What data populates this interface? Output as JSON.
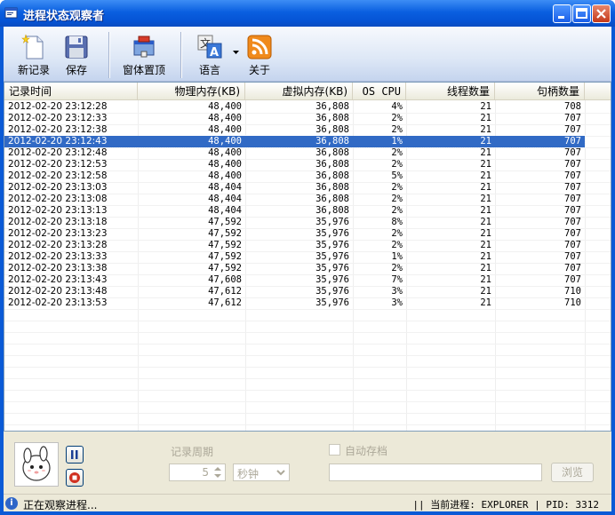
{
  "window": {
    "title": "进程状态观察者"
  },
  "toolbar": {
    "new_record": "新记录",
    "save": "保存",
    "topmost": "窗体置顶",
    "language": "语言",
    "about": "关于"
  },
  "table": {
    "columns": [
      "记录时间",
      "物理内存(KB)",
      "虚拟内存(KB)",
      "OS CPU",
      "线程数量",
      "句柄数量"
    ],
    "rows": [
      [
        "2012-02-20 23:12:28",
        "48,400",
        "36,808",
        "4%",
        "21",
        "708"
      ],
      [
        "2012-02-20 23:12:33",
        "48,400",
        "36,808",
        "2%",
        "21",
        "707"
      ],
      [
        "2012-02-20 23:12:38",
        "48,400",
        "36,808",
        "2%",
        "21",
        "707"
      ],
      [
        "2012-02-20 23:12:43",
        "48,400",
        "36,808",
        "1%",
        "21",
        "707"
      ],
      [
        "2012-02-20 23:12:48",
        "48,400",
        "36,808",
        "2%",
        "21",
        "707"
      ],
      [
        "2012-02-20 23:12:53",
        "48,400",
        "36,808",
        "2%",
        "21",
        "707"
      ],
      [
        "2012-02-20 23:12:58",
        "48,400",
        "36,808",
        "5%",
        "21",
        "707"
      ],
      [
        "2012-02-20 23:13:03",
        "48,404",
        "36,808",
        "2%",
        "21",
        "707"
      ],
      [
        "2012-02-20 23:13:08",
        "48,404",
        "36,808",
        "2%",
        "21",
        "707"
      ],
      [
        "2012-02-20 23:13:13",
        "48,404",
        "36,808",
        "2%",
        "21",
        "707"
      ],
      [
        "2012-02-20 23:13:18",
        "47,592",
        "35,976",
        "8%",
        "21",
        "707"
      ],
      [
        "2012-02-20 23:13:23",
        "47,592",
        "35,976",
        "2%",
        "21",
        "707"
      ],
      [
        "2012-02-20 23:13:28",
        "47,592",
        "35,976",
        "2%",
        "21",
        "707"
      ],
      [
        "2012-02-20 23:13:33",
        "47,592",
        "35,976",
        "1%",
        "21",
        "707"
      ],
      [
        "2012-02-20 23:13:38",
        "47,592",
        "35,976",
        "2%",
        "21",
        "707"
      ],
      [
        "2012-02-20 23:13:43",
        "47,608",
        "35,976",
        "7%",
        "21",
        "707"
      ],
      [
        "2012-02-20 23:13:48",
        "47,612",
        "35,976",
        "3%",
        "21",
        "710"
      ],
      [
        "2012-02-20 23:13:53",
        "47,612",
        "35,976",
        "3%",
        "21",
        "710"
      ]
    ],
    "selected_row": 3
  },
  "controls": {
    "period_label": "记录周期",
    "period_value": "5",
    "period_unit": "秒钟",
    "autosave_label": "自动存档",
    "browse": "浏览"
  },
  "status": {
    "message": "正在观察进程...",
    "process": "|| 当前进程: EXPLORER | PID: 3312"
  },
  "colors": {
    "title_blue": "#0a5fe0",
    "selection": "#316ac5"
  }
}
